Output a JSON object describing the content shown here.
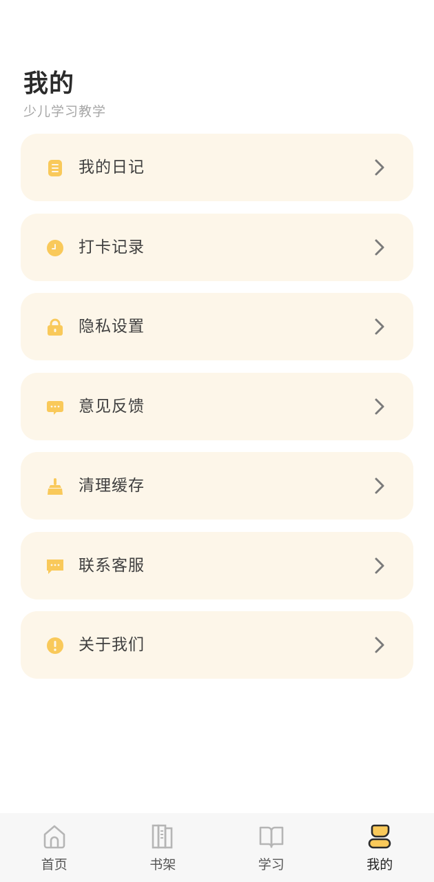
{
  "header": {
    "title": "我的",
    "subtitle": "少儿学习教学"
  },
  "colors": {
    "accent": "#F9C95A",
    "card_bg": "#FDF6E9",
    "tab_inactive": "#B5B5B5",
    "tab_active": "#333333",
    "chevron": "#7A7A7A"
  },
  "menu": {
    "items": [
      {
        "label": "我的日记",
        "icon": "diary-icon"
      },
      {
        "label": "打卡记录",
        "icon": "clock-icon"
      },
      {
        "label": "隐私设置",
        "icon": "lock-icon"
      },
      {
        "label": "意见反馈",
        "icon": "feedback-icon"
      },
      {
        "label": "清理缓存",
        "icon": "broom-icon"
      },
      {
        "label": "联系客服",
        "icon": "chat-icon"
      },
      {
        "label": "关于我们",
        "icon": "info-icon"
      }
    ]
  },
  "tabbar": {
    "tabs": [
      {
        "label": "首页",
        "icon": "home-icon",
        "active": false
      },
      {
        "label": "书架",
        "icon": "bookshelf-icon",
        "active": false
      },
      {
        "label": "学习",
        "icon": "book-open-icon",
        "active": false
      },
      {
        "label": "我的",
        "icon": "profile-icon",
        "active": true
      }
    ]
  }
}
